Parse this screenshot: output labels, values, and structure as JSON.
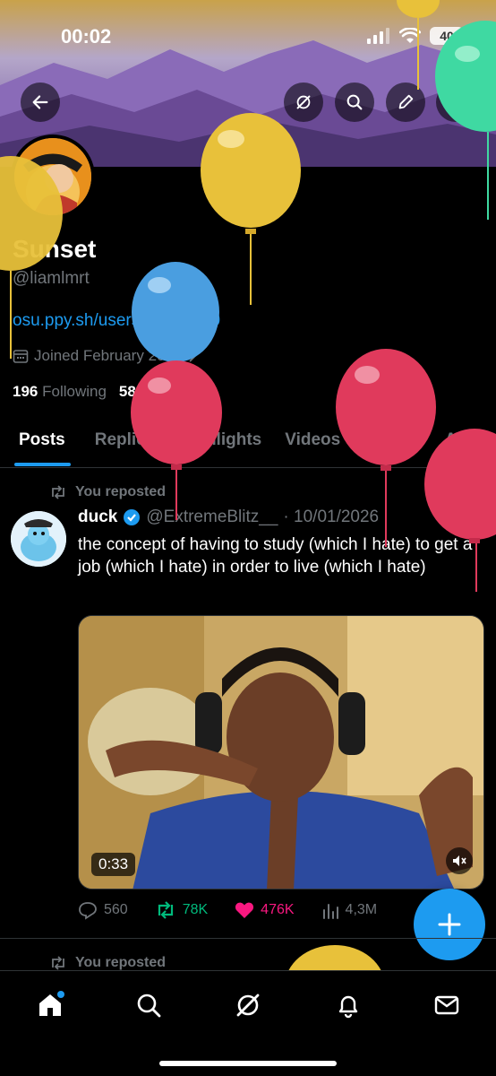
{
  "status_bar": {
    "time": "00:02",
    "battery": "40"
  },
  "profile": {
    "display_name": "Sunset",
    "handle": "@liamlmrt",
    "link": "osu.ppy.sh/users/18496120",
    "joined": "Joined February 2022",
    "following_count": "196",
    "following_label": "Following",
    "followers_count": "58",
    "followers_label": "Followers"
  },
  "tabs": [
    "Posts",
    "Replies",
    "Highlights",
    "Videos",
    "Photos",
    "Art"
  ],
  "post": {
    "repost_label": "You reposted",
    "author_name": "duck",
    "author_handle": "@ExtremeBlitz__",
    "date": "· 10/01/2026",
    "text": "the concept of having to study (which I hate) to get a job (which I hate) in order to live (which I hate)",
    "video_duration": "0:33",
    "replies": "560",
    "reposts": "78K",
    "likes": "476K",
    "views": "4,3M"
  },
  "next_post": {
    "repost_label": "You reposted"
  },
  "icons": {
    "back": "arrow-left-icon",
    "grok": "grok-icon",
    "search": "search-icon",
    "edit": "pencil-icon",
    "share": "share-icon",
    "calendar": "calendar-icon",
    "verified": "verified-badge-icon",
    "x": "x-logo-icon",
    "mute": "mute-icon",
    "reply": "reply-icon",
    "repost": "repost-icon",
    "like": "heart-icon",
    "views": "views-icon",
    "compose": "plus-icon",
    "nav_home": "home-icon",
    "nav_search": "search-icon",
    "nav_grok": "grok-icon",
    "nav_notifications": "bell-icon",
    "nav_messages": "mail-icon"
  },
  "colors": {
    "accent": "#1d9bf0",
    "repost_green": "#00ba7c",
    "like_pink": "#f91880",
    "muted_text": "#71767b"
  }
}
